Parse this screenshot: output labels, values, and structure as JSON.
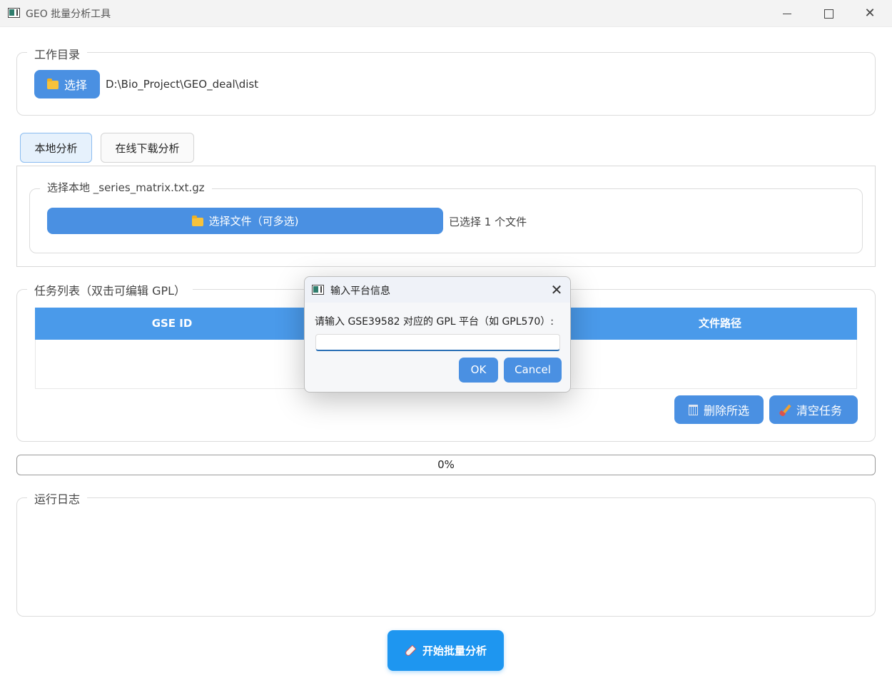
{
  "window": {
    "title": "GEO 批量分析工具",
    "close_glyph": "✕"
  },
  "workdir": {
    "legend": "工作目录",
    "select_label": "选择",
    "path": "D:\\Bio_Project\\GEO_deal\\dist"
  },
  "tabs": [
    {
      "label": "本地分析",
      "active": true
    },
    {
      "label": "在线下载分析",
      "active": false
    }
  ],
  "local": {
    "legend": "选择本地 _series_matrix.txt.gz",
    "choose_files_label": "选择文件（可多选)",
    "selected_status": "已选择 1 个文件"
  },
  "tasks": {
    "legend": "任务列表（双击可编辑 GPL）",
    "columns": [
      "GSE ID",
      "文件路径"
    ],
    "delete_label": "删除所选",
    "clear_label": "清空任务"
  },
  "progress": {
    "value": 0,
    "text": "0%"
  },
  "log": {
    "legend": "运行日志"
  },
  "start_label": "开始批量分析",
  "dialog": {
    "title": "输入平台信息",
    "prompt": "请输入 GSE39582 对应的 GPL 平台（如 GPL570）:",
    "input_value": "",
    "ok_label": "OK",
    "cancel_label": "Cancel",
    "close_glyph": "✕"
  },
  "colors": {
    "accent": "#4a90e2",
    "table_header": "#4a9aea",
    "start_button": "#1e96f0"
  }
}
